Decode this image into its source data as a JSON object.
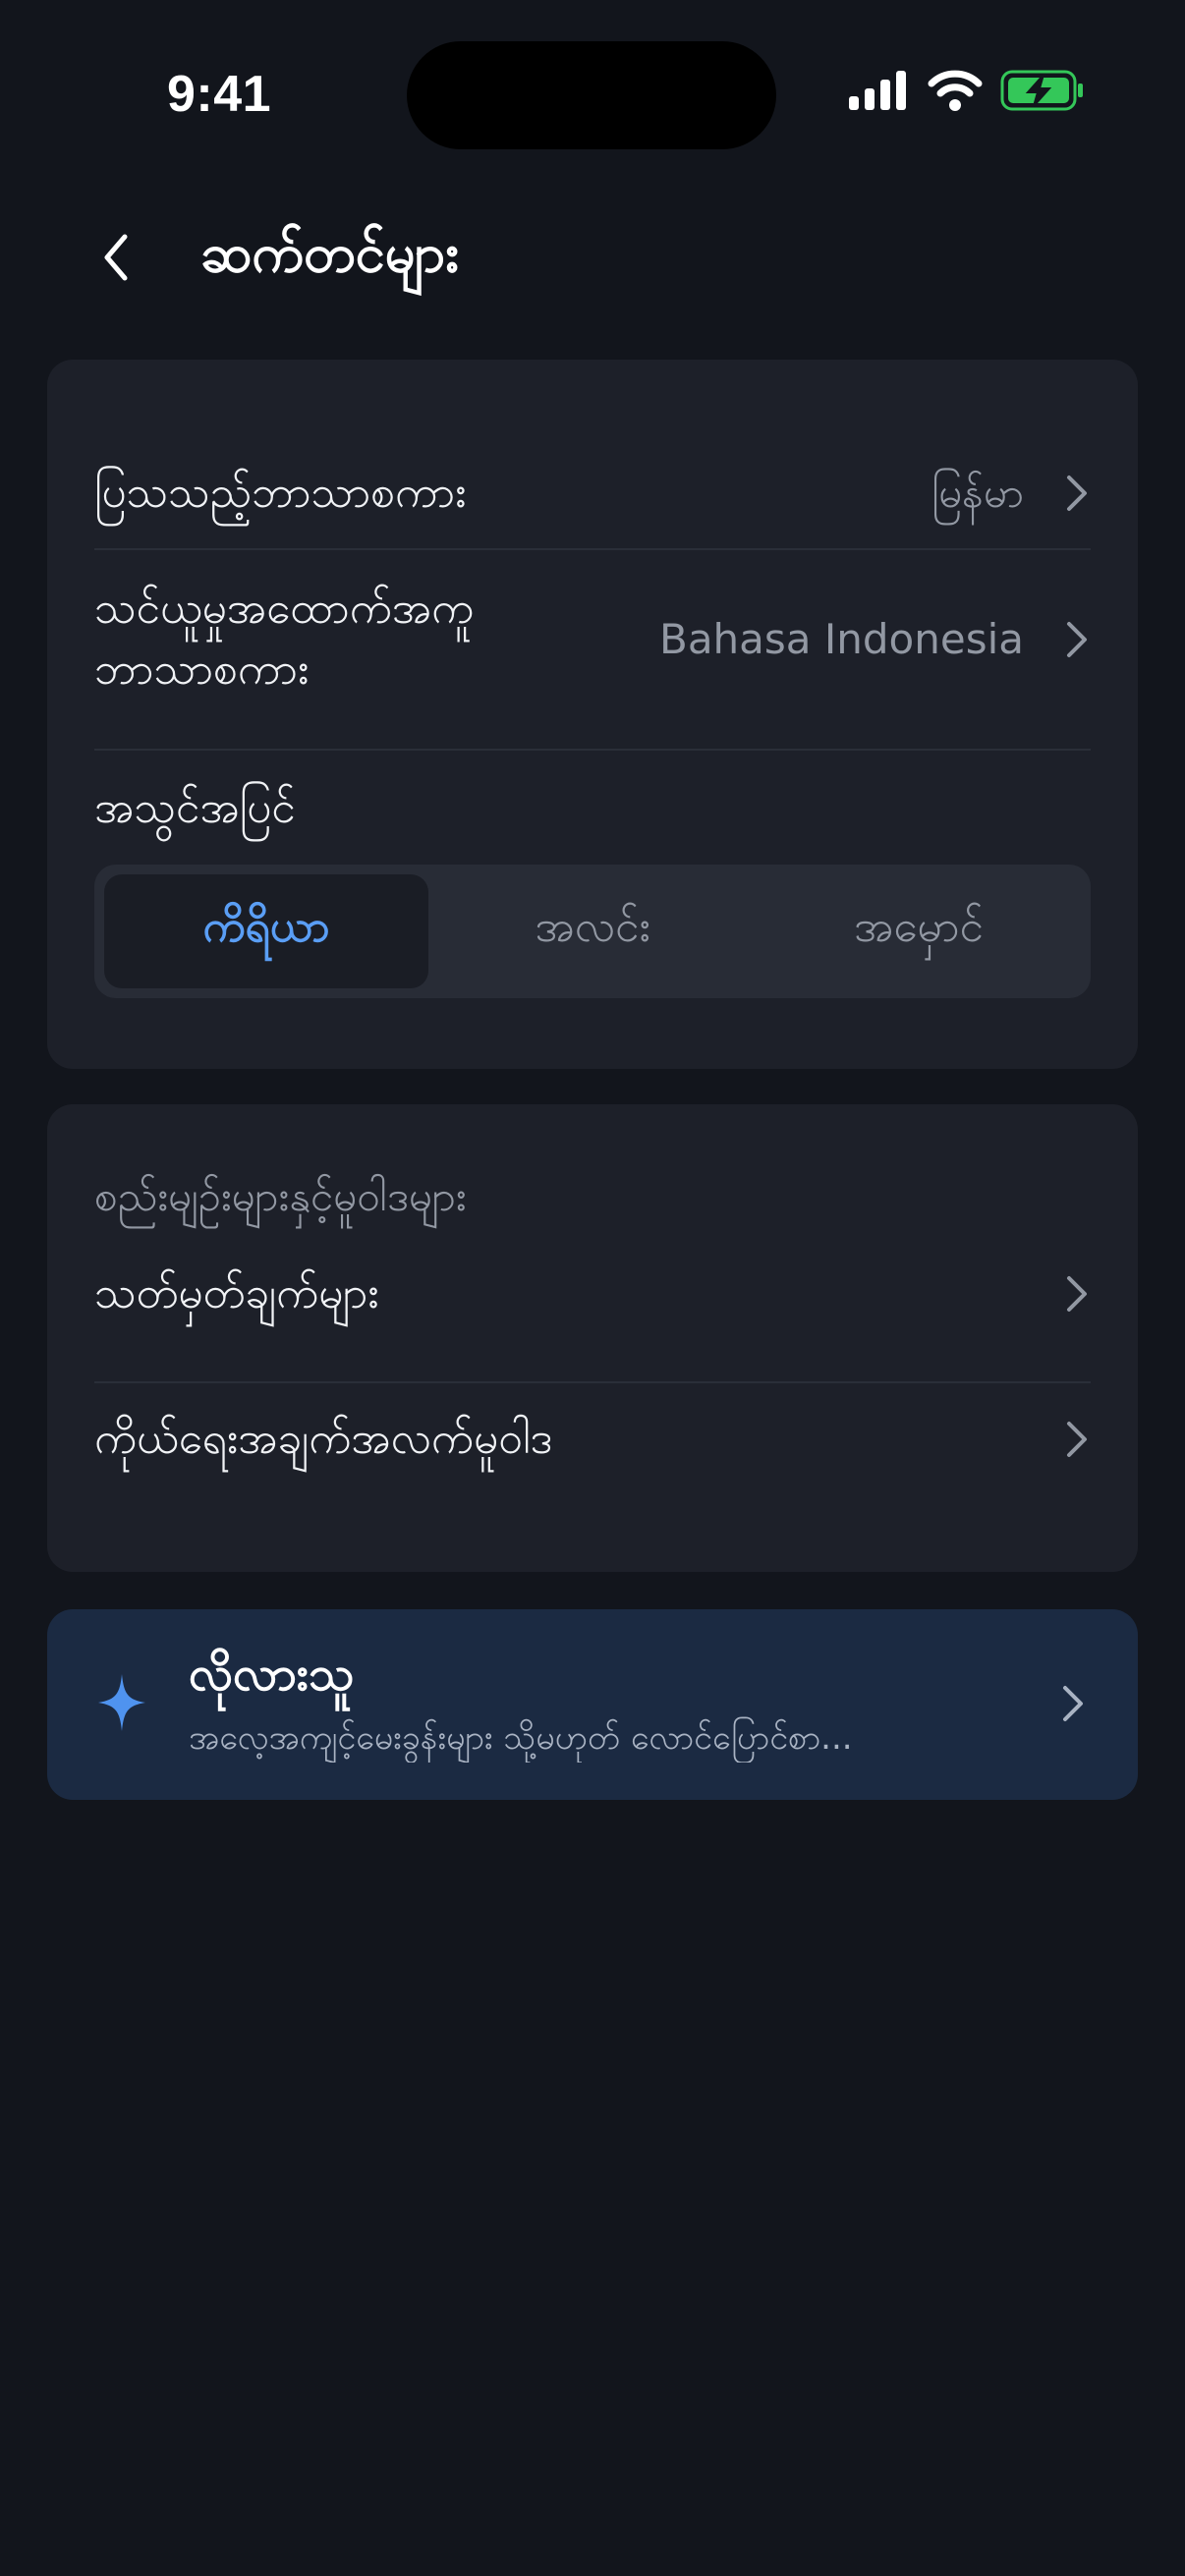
{
  "status_bar": {
    "time": "9:41"
  },
  "header": {
    "title": "ဆက်တင်များ",
    "back_icon": "chevron-left-icon"
  },
  "settings": {
    "display_language": {
      "label": "ပြသသည့်ဘာသာစကား",
      "value": "မြန်မာ"
    },
    "learning_language": {
      "label_line1": "သင်ယူမှုအထောက်အကူ",
      "label_line2": "ဘာသာစကား",
      "value": "Bahasa Indonesia"
    },
    "appearance": {
      "label": "အသွင်အပြင်",
      "options": [
        "ကိရိယာ",
        "အလင်း",
        "အမှောင်"
      ],
      "selected": "ကိရိယာ"
    }
  },
  "policies": {
    "heading": "စည်းမျဉ်းများနှင့်မူဝါဒများ",
    "items": [
      {
        "label": "သတ်မှတ်ချက်များ"
      },
      {
        "label": "ကိုယ်ရေးအချက်အလက်မူဝါဒ"
      }
    ]
  },
  "feedback": {
    "icon": "sparkle-icon",
    "title": "လိုလားသူ",
    "subtitle": "အလေ့အကျင့်မေးခွန်းများ သို့မဟုတ် လောင်ပြောင်စာ..."
  },
  "colors": {
    "background": "#12151c",
    "card": "#1d2029",
    "accent": "#5a9ef5",
    "feedback_card": "#1b2a42",
    "battery_green": "#34c759"
  }
}
